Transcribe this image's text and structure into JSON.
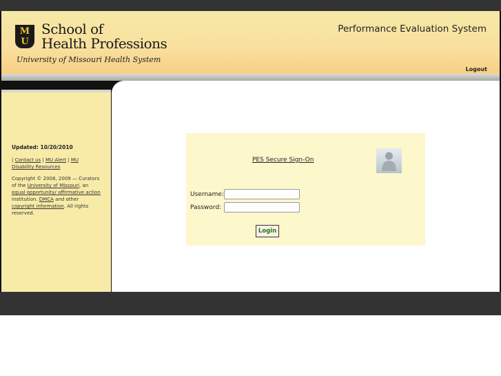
{
  "header": {
    "logo_mark": "MU",
    "school_line1": "School of",
    "school_line2": "Health Professions",
    "university": "University of Missouri Health System",
    "app_title": "Performance Evaluation System",
    "logout": "Logout"
  },
  "sidebar": {
    "updated": "Updated: 10/20/2010",
    "links": [
      "Contact us",
      "MU Alert",
      "MU Disability Resources"
    ],
    "copyright": {
      "text1": "Copyright © 2008, 2009 — Curators of the ",
      "link1": "University of Missouri",
      "text2": ", an ",
      "link2": "equal opportunity/ affirmative action",
      "text3": " institution. ",
      "link3": "DMCA",
      "text4": " and other ",
      "link4": "copyright information",
      "text5": ". All rights reserved."
    }
  },
  "login": {
    "title": "PES Secure Sign-On",
    "username_label": "Username:",
    "password_label": "Password:",
    "username_value": "",
    "password_value": "",
    "button": "Login"
  }
}
